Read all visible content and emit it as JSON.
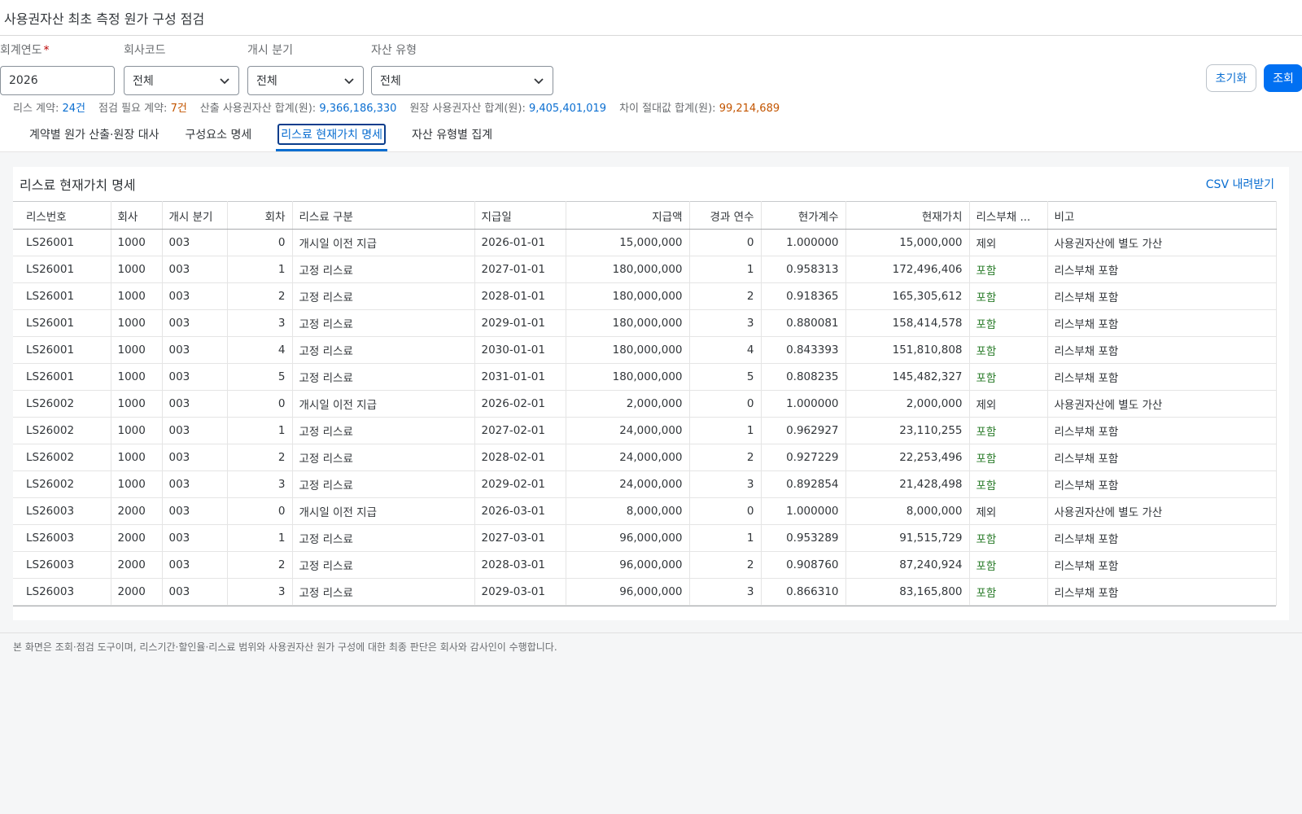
{
  "header": {
    "title": "사용권자산 최초 측정 원가 구성 점검"
  },
  "filters": {
    "fiscal_year": {
      "label": "회계연도",
      "required_mark": "*",
      "value": "2026"
    },
    "company_code": {
      "label": "회사코드",
      "value": "전체"
    },
    "start_quarter": {
      "label": "개시 분기",
      "value": "전체"
    },
    "asset_type": {
      "label": "자산 유형",
      "value": "전체"
    }
  },
  "buttons": {
    "reset": "초기화",
    "search": "조회"
  },
  "summary": {
    "lease_count_label": "리스 계약:",
    "lease_count_value": "24건",
    "check_needed_label": "점검 필요 계약:",
    "check_needed_value": "7건",
    "calc_total_label": "산출 사용권자산 합계(원):",
    "calc_total_value": "9,366,186,330",
    "ledger_total_label": "원장 사용권자산 합계(원):",
    "ledger_total_value": "9,405,401,019",
    "diff_label": "차이 절대값 합계(원):",
    "diff_value": "99,214,689"
  },
  "tabs": [
    {
      "label": "계약별 원가 산출·원장 대사"
    },
    {
      "label": "구성요소 명세"
    },
    {
      "label": "리스료 현재가치 명세"
    },
    {
      "label": "자산 유형별 집계"
    }
  ],
  "panel": {
    "title": "리스료 현재가치 명세",
    "csv": "CSV 내려받기"
  },
  "columns": [
    "리스번호",
    "회사",
    "개시 분기",
    "회차",
    "리스료 구분",
    "지급일",
    "지급액",
    "경과 연수",
    "현가계수",
    "현재가치",
    "리스부채 ...",
    "비고"
  ],
  "rows": [
    [
      "LS26001",
      "1000",
      "003",
      "0",
      "개시일 이전 지급",
      "2026-01-01",
      "15,000,000",
      "0",
      "1.000000",
      "15,000,000",
      "제외",
      "사용권자산에 별도 가산"
    ],
    [
      "LS26001",
      "1000",
      "003",
      "1",
      "고정 리스료",
      "2027-01-01",
      "180,000,000",
      "1",
      "0.958313",
      "172,496,406",
      "포함",
      "리스부채 포함"
    ],
    [
      "LS26001",
      "1000",
      "003",
      "2",
      "고정 리스료",
      "2028-01-01",
      "180,000,000",
      "2",
      "0.918365",
      "165,305,612",
      "포함",
      "리스부채 포함"
    ],
    [
      "LS26001",
      "1000",
      "003",
      "3",
      "고정 리스료",
      "2029-01-01",
      "180,000,000",
      "3",
      "0.880081",
      "158,414,578",
      "포함",
      "리스부채 포함"
    ],
    [
      "LS26001",
      "1000",
      "003",
      "4",
      "고정 리스료",
      "2030-01-01",
      "180,000,000",
      "4",
      "0.843393",
      "151,810,808",
      "포함",
      "리스부채 포함"
    ],
    [
      "LS26001",
      "1000",
      "003",
      "5",
      "고정 리스료",
      "2031-01-01",
      "180,000,000",
      "5",
      "0.808235",
      "145,482,327",
      "포함",
      "리스부채 포함"
    ],
    [
      "LS26002",
      "1000",
      "003",
      "0",
      "개시일 이전 지급",
      "2026-02-01",
      "2,000,000",
      "0",
      "1.000000",
      "2,000,000",
      "제외",
      "사용권자산에 별도 가산"
    ],
    [
      "LS26002",
      "1000",
      "003",
      "1",
      "고정 리스료",
      "2027-02-01",
      "24,000,000",
      "1",
      "0.962927",
      "23,110,255",
      "포함",
      "리스부채 포함"
    ],
    [
      "LS26002",
      "1000",
      "003",
      "2",
      "고정 리스료",
      "2028-02-01",
      "24,000,000",
      "2",
      "0.927229",
      "22,253,496",
      "포함",
      "리스부채 포함"
    ],
    [
      "LS26002",
      "1000",
      "003",
      "3",
      "고정 리스료",
      "2029-02-01",
      "24,000,000",
      "3",
      "0.892854",
      "21,428,498",
      "포함",
      "리스부채 포함"
    ],
    [
      "LS26003",
      "2000",
      "003",
      "0",
      "개시일 이전 지급",
      "2026-03-01",
      "8,000,000",
      "0",
      "1.000000",
      "8,000,000",
      "제외",
      "사용권자산에 별도 가산"
    ],
    [
      "LS26003",
      "2000",
      "003",
      "1",
      "고정 리스료",
      "2027-03-01",
      "96,000,000",
      "1",
      "0.953289",
      "91,515,729",
      "포함",
      "리스부채 포함"
    ],
    [
      "LS26003",
      "2000",
      "003",
      "2",
      "고정 리스료",
      "2028-03-01",
      "96,000,000",
      "2",
      "0.908760",
      "87,240,924",
      "포함",
      "리스부채 포함"
    ],
    [
      "LS26003",
      "2000",
      "003",
      "3",
      "고정 리스료",
      "2029-03-01",
      "96,000,000",
      "3",
      "0.866310",
      "83,165,800",
      "포함",
      "리스부채 포함"
    ]
  ],
  "footnote": "본 화면은 조회·점검 도구이며, 리스기간·할인율·리스료 범위와 사용권자산 원가 구성에 대한 최종 판단은 회사와 감사인이 수행합니다.",
  "icons": {
    "select_chevron": "chevron-down-icon"
  },
  "colors": {
    "accent": "#0a6ed1",
    "primary_button": "#0070f2",
    "warning": "#c35500",
    "included": "#2b7c2b",
    "required": "#bb0000"
  }
}
